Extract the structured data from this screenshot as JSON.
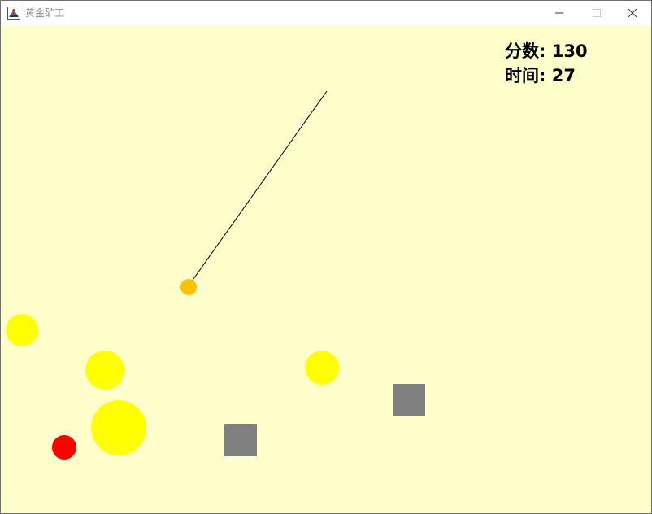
{
  "window": {
    "title": "黄金矿工"
  },
  "hud": {
    "score_label": "分数:",
    "score_value": "130",
    "time_label": "时间:",
    "time_value": "27"
  },
  "colors": {
    "background": "#ffffcc",
    "gold": "#ffff00",
    "hook": "#ffc000",
    "diamond": "#ff0000",
    "stone": "#808080",
    "rope": "#000000"
  },
  "icons": {
    "app": "gold-miner-app-icon",
    "minimize": "minimize-icon",
    "maximize": "maximize-icon",
    "close": "close-icon"
  }
}
